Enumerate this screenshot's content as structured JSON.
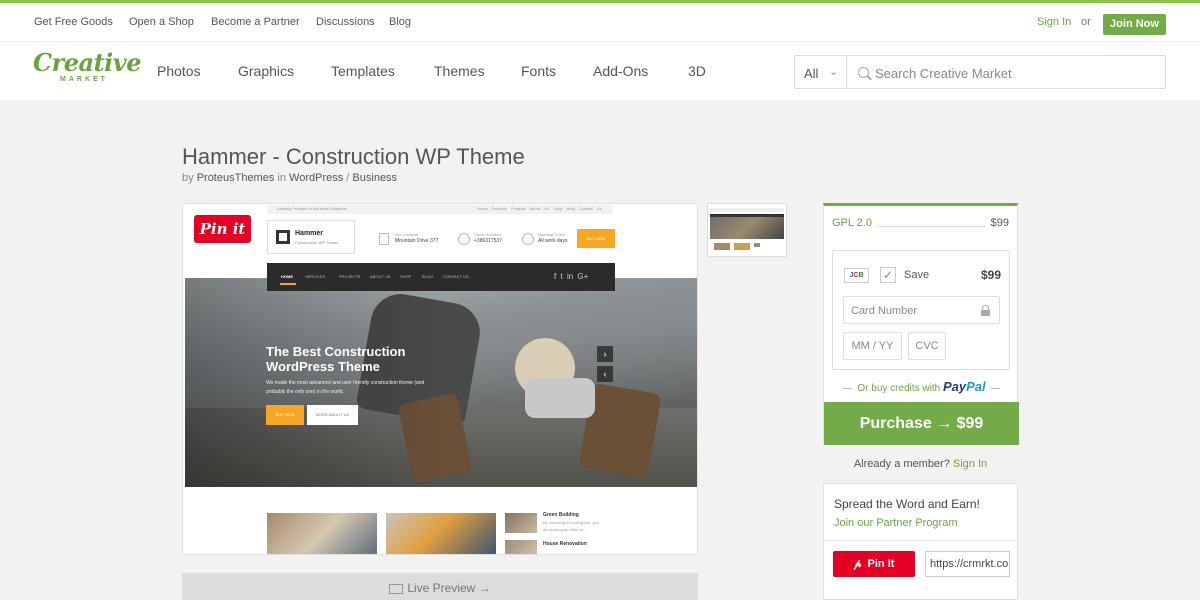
{
  "topbar": {
    "links": [
      "Get Free Goods",
      "Open a Shop",
      "Become a Partner",
      "Discussions",
      "Blog"
    ],
    "sign_in": "Sign In",
    "or": "or",
    "join_now": "Join Now"
  },
  "logo": {
    "line1": "Creative",
    "line2": "MARKET"
  },
  "nav": {
    "items": [
      "Photos",
      "Graphics",
      "Templates",
      "Themes",
      "Fonts",
      "Add-Ons",
      "3D"
    ]
  },
  "search": {
    "category": "All",
    "placeholder": "Search Creative Market"
  },
  "product": {
    "title": "Hammer - Construction WP Theme",
    "by": "by",
    "author": "ProteusThemes",
    "in": "in",
    "category": "WordPress",
    "separator": "/",
    "subcategory": "Business",
    "pin_it": "Pin it",
    "live_preview": "Live Preview →"
  },
  "preview_site": {
    "tagline": "Leading Provider of Industrial Solutions",
    "top_links": [
      "Home",
      "Services",
      "Projects",
      "About Us",
      "Shop",
      "Blog",
      "Contact Us"
    ],
    "logo_name": "Hammer",
    "logo_sub": "Construction WP Theme",
    "info": [
      {
        "label": "Our Location",
        "value": "Mountain Drive 377"
      },
      {
        "label": "Phone Number",
        "value": "+386317537"
      },
      {
        "label": "Opening Times",
        "value": "All work days"
      }
    ],
    "buy_now": "BUY NOW",
    "menu": [
      "HOME",
      "SERVICES",
      "PROJECTS",
      "ABOUT US",
      "SHOP",
      "BLOG",
      "CONTACT US"
    ],
    "social": [
      "f",
      "t",
      "in",
      "G+"
    ],
    "hero_title_1": "The Best Construction",
    "hero_title_2": "WordPress Theme",
    "hero_text_1": "We made the most advanced and user friendly construction theme (and",
    "hero_text_2": "probably the only one) in the world.",
    "hero_btn1": "BUY NOW",
    "hero_btn2": "MORE ABOUT US",
    "news": [
      {
        "title": "Green Building",
        "text": "By choosing to build green, you",
        "text2": "are making an effort to ..."
      },
      {
        "title": "House Renovation",
        "text": "",
        "text2": ""
      }
    ]
  },
  "purchase": {
    "license": "GPL 2.0",
    "license_price": "$99",
    "card_brand": "JCB",
    "save_label": "Save",
    "save_price": "$99",
    "card_number_placeholder": "Card Number",
    "expiry_placeholder": "MM / YY",
    "cvc_placeholder": "CVC",
    "paypal_text": "Or buy credits with",
    "paypal_brand_1": "Pay",
    "paypal_brand_2": "Pal",
    "purchase_button": "Purchase → $99",
    "member_text": "Already a member?",
    "member_link": "Sign In"
  },
  "share": {
    "title": "Spread the Word and Earn!",
    "partner_link": "Join our Partner Program",
    "pin_button": "Pin It",
    "link_value": "https://crmrkt.com"
  },
  "colors": {
    "brand_green": "#72ab47",
    "pinterest_red": "#e60023",
    "accent_orange": "#f5a623"
  }
}
